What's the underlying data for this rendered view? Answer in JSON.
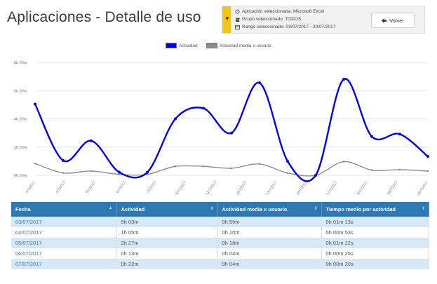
{
  "header": {
    "title": "Aplicaciones - Detalle de uso",
    "filters": [
      {
        "icon": "app-icon",
        "text": "Aplicación seleccionada: Microsoft Excel"
      },
      {
        "icon": "group-icon",
        "text": "Grupo seleccionado: TODOS"
      },
      {
        "icon": "calendar-icon",
        "text": "Rango seleccionado: 03/07/2017 - 20/07/2017"
      }
    ],
    "back_label": "Volver",
    "accent_color": "#f3c316"
  },
  "chart_data": {
    "type": "line",
    "categories": [
      "3/7/2017",
      "4/7/2017",
      "5/7/2017",
      "6/7/2017",
      "7/7/2017",
      "10/7/2017",
      "11/7/2017",
      "12/7/2017",
      "13/7/2017",
      "14/7/2017",
      "17/7/2017",
      "18/7/2017",
      "19/7/2017",
      "20/7/2017"
    ],
    "yticks": [
      "0h 00m",
      "2h 00m",
      "4h 00m",
      "6h 00m",
      "8h 00m"
    ],
    "ylim": [
      0,
      480
    ],
    "legend_position": "top-center",
    "grid": true,
    "series": [
      {
        "name": "Actividad",
        "color": "#0000ee",
        "values": [
          303,
          63,
          147,
          13,
          13,
          240,
          285,
          180,
          393,
          60,
          0,
          408,
          165,
          175,
          80
        ]
      },
      {
        "name": "Actividad media x usuario",
        "color": "#8c8c8c",
        "values": [
          50,
          10,
          18,
          4,
          4,
          38,
          38,
          30,
          48,
          10,
          0,
          58,
          22,
          24,
          18
        ]
      }
    ]
  },
  "table": {
    "columns": [
      "Fecha",
      "Actividad",
      "Actividad media x usuario",
      "Tiempo medio por actividad"
    ],
    "rows": [
      [
        "03/07/2017",
        "5h 03m",
        "0h 50m",
        "0h 01m 13s"
      ],
      [
        "04/07/2017",
        "1h 05m",
        "0h 10m",
        "0h 00m 53s"
      ],
      [
        "05/07/2017",
        "2h 27m",
        "0h 18m",
        "0h 01m 12s"
      ],
      [
        "06/07/2017",
        "0h 13m",
        "0h 04m",
        "0h 00m 25s"
      ],
      [
        "07/07/2017",
        "0h 22m",
        "0h 04m",
        "0h 00m 20s"
      ]
    ]
  }
}
